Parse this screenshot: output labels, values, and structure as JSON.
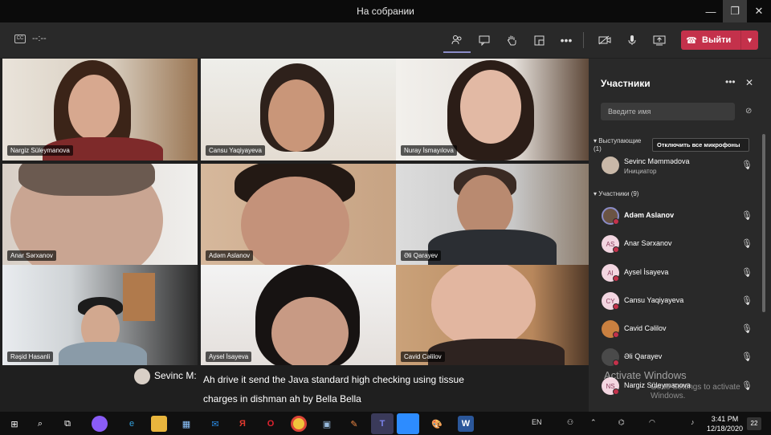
{
  "window": {
    "title": "На собрании",
    "min": "—",
    "max": "❐",
    "close": "✕"
  },
  "toolbar": {
    "cc_label": "CC",
    "timer": "--:--",
    "leave_label": "Выйти"
  },
  "tiles": [
    {
      "name": "Nargiz Süleymanova"
    },
    {
      "name": "Cansu Yaqiyayeva"
    },
    {
      "name": "Nuray İsmayılova"
    },
    {
      "name": "Anar Sərxanov"
    },
    {
      "name": "Adəm Aslanov"
    },
    {
      "name": "Əli Qarayev"
    },
    {
      "name": "Rəşid Hasanli"
    },
    {
      "name": "Aysel İsayeva"
    },
    {
      "name": "Cavid Cəlilov"
    }
  ],
  "caption": {
    "speaker": "Sevinc M:",
    "line1": "Ah drive it send the Java standard high checking using tissue",
    "line2": "charges in dishman ah by Bella Bella"
  },
  "panel": {
    "title": "Участники",
    "search_placeholder": "Введите имя",
    "presenters_label": "Выступающие (1)",
    "mute_all_label": "Отключить все микрофоны",
    "presenter": {
      "name": "Sevinc Məmmədova",
      "role": "Инициатор"
    },
    "attendees_label": "Участники (9)",
    "attendees": [
      {
        "name": "Adəm Aslanov",
        "initials": "",
        "bold": true
      },
      {
        "name": "Anar Sərxanov",
        "initials": "AS",
        "bold": false
      },
      {
        "name": "Aysel İsayeva",
        "initials": "AI",
        "bold": false
      },
      {
        "name": "Cansu Yaqiyayeva",
        "initials": "CY",
        "bold": false
      },
      {
        "name": "Cavid Cəlilov",
        "initials": "",
        "bold": false
      },
      {
        "name": "Əli Qarayev",
        "initials": "",
        "bold": false
      },
      {
        "name": "Nargiz Süleymanova",
        "initials": "NS",
        "bold": false
      }
    ]
  },
  "watermark": {
    "line1": "Activate Windows",
    "line2": "Go to Settings to activate Windows."
  },
  "taskbar": {
    "lang": "EN",
    "time": "3:41 PM",
    "date": "12/18/2020",
    "notif_count": "22"
  }
}
